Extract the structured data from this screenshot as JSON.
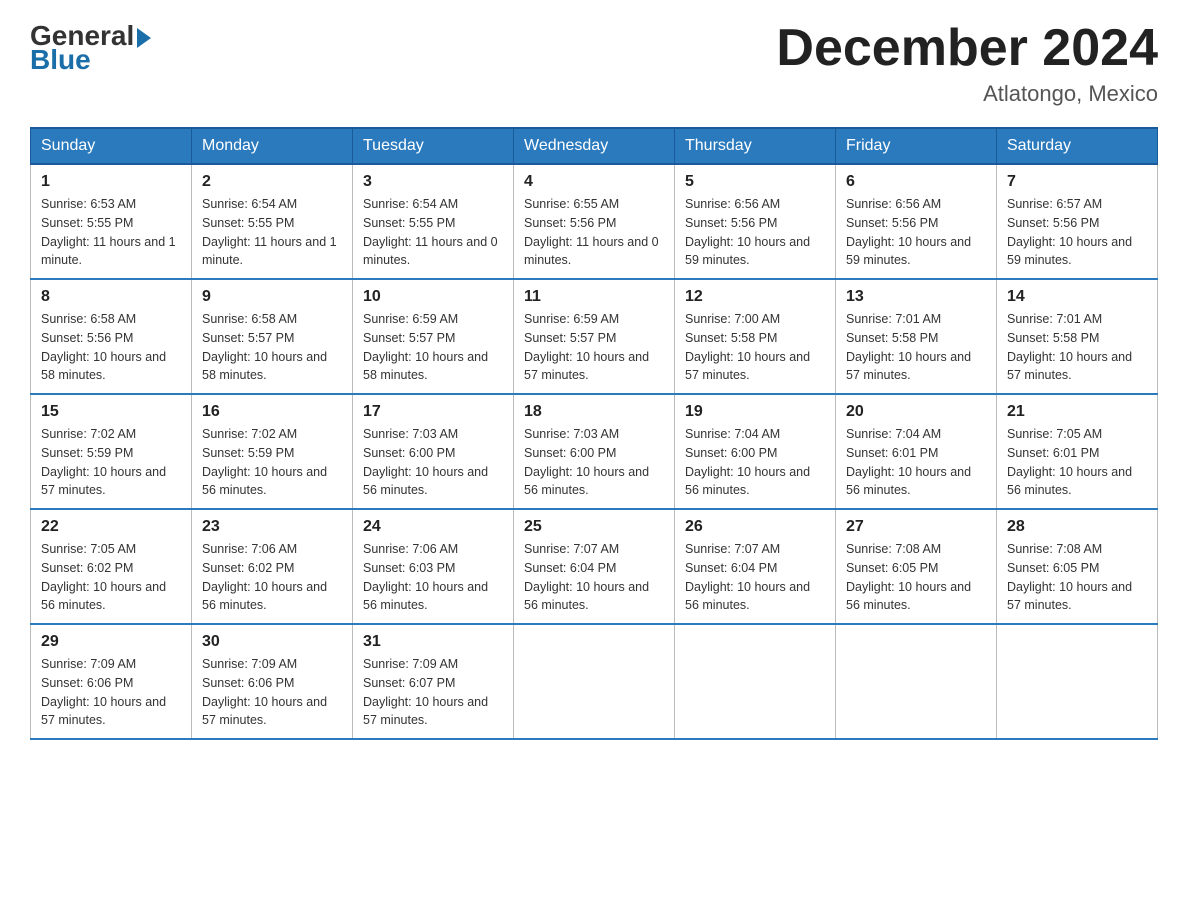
{
  "header": {
    "logo": {
      "general": "General",
      "blue": "Blue"
    },
    "title": "December 2024",
    "location": "Atlatongo, Mexico"
  },
  "days_of_week": [
    "Sunday",
    "Monday",
    "Tuesday",
    "Wednesday",
    "Thursday",
    "Friday",
    "Saturday"
  ],
  "weeks": [
    [
      {
        "day": "1",
        "sunrise": "Sunrise: 6:53 AM",
        "sunset": "Sunset: 5:55 PM",
        "daylight": "Daylight: 11 hours and 1 minute."
      },
      {
        "day": "2",
        "sunrise": "Sunrise: 6:54 AM",
        "sunset": "Sunset: 5:55 PM",
        "daylight": "Daylight: 11 hours and 1 minute."
      },
      {
        "day": "3",
        "sunrise": "Sunrise: 6:54 AM",
        "sunset": "Sunset: 5:55 PM",
        "daylight": "Daylight: 11 hours and 0 minutes."
      },
      {
        "day": "4",
        "sunrise": "Sunrise: 6:55 AM",
        "sunset": "Sunset: 5:56 PM",
        "daylight": "Daylight: 11 hours and 0 minutes."
      },
      {
        "day": "5",
        "sunrise": "Sunrise: 6:56 AM",
        "sunset": "Sunset: 5:56 PM",
        "daylight": "Daylight: 10 hours and 59 minutes."
      },
      {
        "day": "6",
        "sunrise": "Sunrise: 6:56 AM",
        "sunset": "Sunset: 5:56 PM",
        "daylight": "Daylight: 10 hours and 59 minutes."
      },
      {
        "day": "7",
        "sunrise": "Sunrise: 6:57 AM",
        "sunset": "Sunset: 5:56 PM",
        "daylight": "Daylight: 10 hours and 59 minutes."
      }
    ],
    [
      {
        "day": "8",
        "sunrise": "Sunrise: 6:58 AM",
        "sunset": "Sunset: 5:56 PM",
        "daylight": "Daylight: 10 hours and 58 minutes."
      },
      {
        "day": "9",
        "sunrise": "Sunrise: 6:58 AM",
        "sunset": "Sunset: 5:57 PM",
        "daylight": "Daylight: 10 hours and 58 minutes."
      },
      {
        "day": "10",
        "sunrise": "Sunrise: 6:59 AM",
        "sunset": "Sunset: 5:57 PM",
        "daylight": "Daylight: 10 hours and 58 minutes."
      },
      {
        "day": "11",
        "sunrise": "Sunrise: 6:59 AM",
        "sunset": "Sunset: 5:57 PM",
        "daylight": "Daylight: 10 hours and 57 minutes."
      },
      {
        "day": "12",
        "sunrise": "Sunrise: 7:00 AM",
        "sunset": "Sunset: 5:58 PM",
        "daylight": "Daylight: 10 hours and 57 minutes."
      },
      {
        "day": "13",
        "sunrise": "Sunrise: 7:01 AM",
        "sunset": "Sunset: 5:58 PM",
        "daylight": "Daylight: 10 hours and 57 minutes."
      },
      {
        "day": "14",
        "sunrise": "Sunrise: 7:01 AM",
        "sunset": "Sunset: 5:58 PM",
        "daylight": "Daylight: 10 hours and 57 minutes."
      }
    ],
    [
      {
        "day": "15",
        "sunrise": "Sunrise: 7:02 AM",
        "sunset": "Sunset: 5:59 PM",
        "daylight": "Daylight: 10 hours and 57 minutes."
      },
      {
        "day": "16",
        "sunrise": "Sunrise: 7:02 AM",
        "sunset": "Sunset: 5:59 PM",
        "daylight": "Daylight: 10 hours and 56 minutes."
      },
      {
        "day": "17",
        "sunrise": "Sunrise: 7:03 AM",
        "sunset": "Sunset: 6:00 PM",
        "daylight": "Daylight: 10 hours and 56 minutes."
      },
      {
        "day": "18",
        "sunrise": "Sunrise: 7:03 AM",
        "sunset": "Sunset: 6:00 PM",
        "daylight": "Daylight: 10 hours and 56 minutes."
      },
      {
        "day": "19",
        "sunrise": "Sunrise: 7:04 AM",
        "sunset": "Sunset: 6:00 PM",
        "daylight": "Daylight: 10 hours and 56 minutes."
      },
      {
        "day": "20",
        "sunrise": "Sunrise: 7:04 AM",
        "sunset": "Sunset: 6:01 PM",
        "daylight": "Daylight: 10 hours and 56 minutes."
      },
      {
        "day": "21",
        "sunrise": "Sunrise: 7:05 AM",
        "sunset": "Sunset: 6:01 PM",
        "daylight": "Daylight: 10 hours and 56 minutes."
      }
    ],
    [
      {
        "day": "22",
        "sunrise": "Sunrise: 7:05 AM",
        "sunset": "Sunset: 6:02 PM",
        "daylight": "Daylight: 10 hours and 56 minutes."
      },
      {
        "day": "23",
        "sunrise": "Sunrise: 7:06 AM",
        "sunset": "Sunset: 6:02 PM",
        "daylight": "Daylight: 10 hours and 56 minutes."
      },
      {
        "day": "24",
        "sunrise": "Sunrise: 7:06 AM",
        "sunset": "Sunset: 6:03 PM",
        "daylight": "Daylight: 10 hours and 56 minutes."
      },
      {
        "day": "25",
        "sunrise": "Sunrise: 7:07 AM",
        "sunset": "Sunset: 6:04 PM",
        "daylight": "Daylight: 10 hours and 56 minutes."
      },
      {
        "day": "26",
        "sunrise": "Sunrise: 7:07 AM",
        "sunset": "Sunset: 6:04 PM",
        "daylight": "Daylight: 10 hours and 56 minutes."
      },
      {
        "day": "27",
        "sunrise": "Sunrise: 7:08 AM",
        "sunset": "Sunset: 6:05 PM",
        "daylight": "Daylight: 10 hours and 56 minutes."
      },
      {
        "day": "28",
        "sunrise": "Sunrise: 7:08 AM",
        "sunset": "Sunset: 6:05 PM",
        "daylight": "Daylight: 10 hours and 57 minutes."
      }
    ],
    [
      {
        "day": "29",
        "sunrise": "Sunrise: 7:09 AM",
        "sunset": "Sunset: 6:06 PM",
        "daylight": "Daylight: 10 hours and 57 minutes."
      },
      {
        "day": "30",
        "sunrise": "Sunrise: 7:09 AM",
        "sunset": "Sunset: 6:06 PM",
        "daylight": "Daylight: 10 hours and 57 minutes."
      },
      {
        "day": "31",
        "sunrise": "Sunrise: 7:09 AM",
        "sunset": "Sunset: 6:07 PM",
        "daylight": "Daylight: 10 hours and 57 minutes."
      },
      null,
      null,
      null,
      null
    ]
  ]
}
